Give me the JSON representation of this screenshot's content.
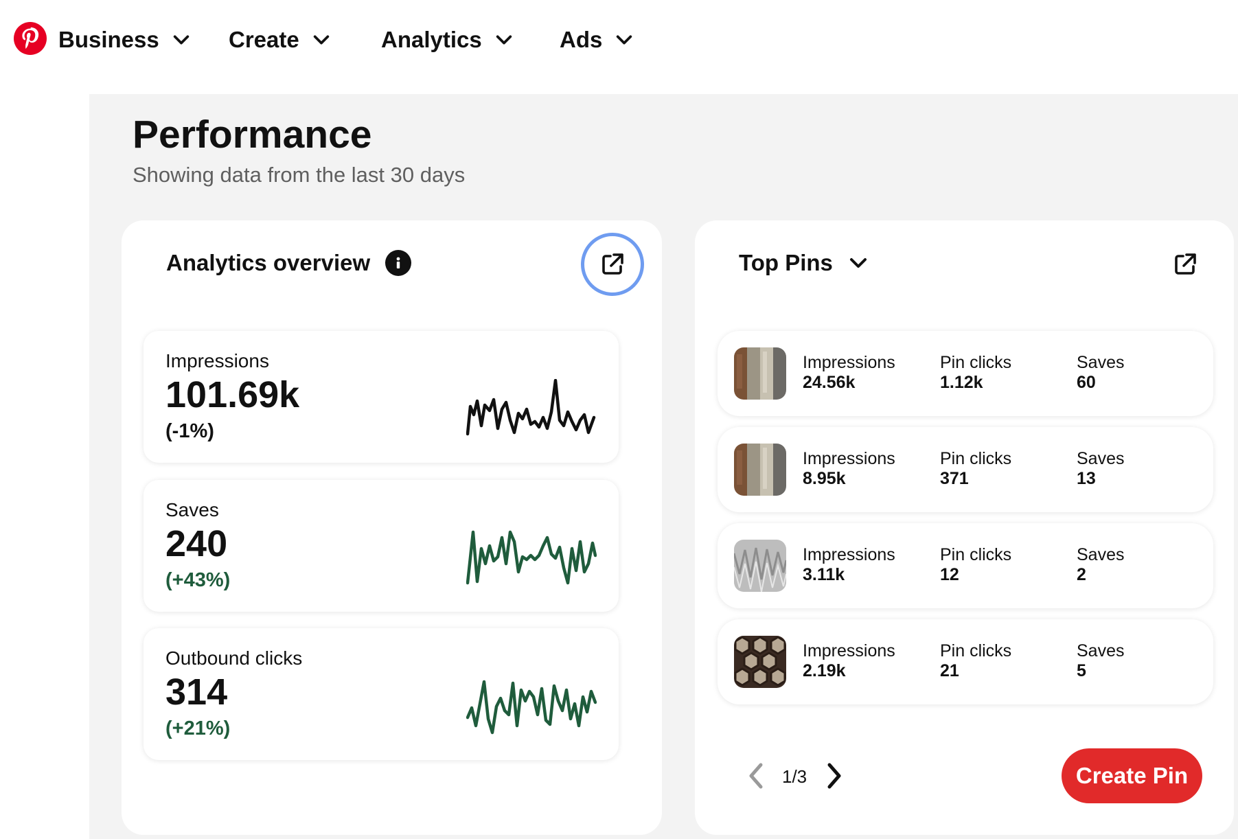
{
  "nav": {
    "logo_icon": "pinterest-logo",
    "items": [
      {
        "label": "Business"
      },
      {
        "label": "Create"
      },
      {
        "label": "Analytics"
      },
      {
        "label": "Ads"
      }
    ]
  },
  "page": {
    "title": "Performance",
    "subtitle": "Showing data from the last 30 days"
  },
  "analytics_overview": {
    "title": "Analytics overview",
    "metrics": [
      {
        "label": "Impressions",
        "value": "101.69k",
        "change": "(-1%)",
        "trend": "negative",
        "color": "#111111"
      },
      {
        "label": "Saves",
        "value": "240",
        "change": "(+43%)",
        "trend": "positive",
        "color": "#1f5c3c"
      },
      {
        "label": "Outbound clicks",
        "value": "314",
        "change": "(+21%)",
        "trend": "positive",
        "color": "#1f5c3c"
      }
    ]
  },
  "top_pins": {
    "title": "Top Pins",
    "labels": {
      "impressions": "Impressions",
      "clicks": "Pin clicks",
      "saves": "Saves"
    },
    "pins": [
      {
        "impressions": "24.56k",
        "clicks": "1.12k",
        "saves": "60"
      },
      {
        "impressions": "8.95k",
        "clicks": "371",
        "saves": "13"
      },
      {
        "impressions": "3.11k",
        "clicks": "12",
        "saves": "2"
      },
      {
        "impressions": "2.19k",
        "clicks": "21",
        "saves": "5"
      }
    ],
    "pagination": "1/3",
    "create_label": "Create Pin"
  },
  "colors": {
    "brand_red": "#e12a2a",
    "positive_green": "#1f5c3c",
    "focus_ring": "#6f9cf0"
  }
}
